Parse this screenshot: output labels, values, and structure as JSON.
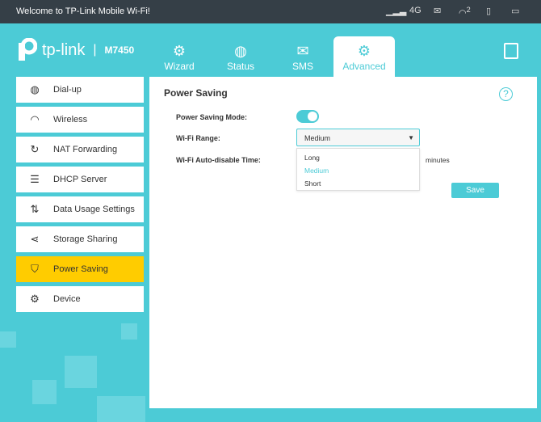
{
  "topbar": {
    "welcome": "Welcome to TP-Link Mobile Wi-Fi!",
    "network": "4G",
    "wifi_clients": "2"
  },
  "header": {
    "brand": "tp-link",
    "model": "M7450",
    "tabs": [
      {
        "label": "Wizard",
        "icon": "gear-icon"
      },
      {
        "label": "Status",
        "icon": "globe-icon"
      },
      {
        "label": "SMS",
        "icon": "envelope-icon"
      },
      {
        "label": "Advanced",
        "icon": "gears-icon",
        "active": true
      }
    ]
  },
  "sidebar": {
    "items": [
      {
        "label": "Dial-up"
      },
      {
        "label": "Wireless"
      },
      {
        "label": "NAT Forwarding"
      },
      {
        "label": "DHCP Server"
      },
      {
        "label": "Data Usage Settings"
      },
      {
        "label": "Storage Sharing"
      },
      {
        "label": "Power Saving",
        "active": true
      },
      {
        "label": "Device"
      }
    ]
  },
  "main": {
    "title": "Power Saving",
    "power_saving_mode_label": "Power Saving Mode:",
    "power_saving_mode": true,
    "wifi_range_label": "Wi-Fi Range:",
    "wifi_range_value": "Medium",
    "wifi_range_options": [
      "Long",
      "Medium",
      "Short"
    ],
    "auto_disable_label": "Wi-Fi Auto-disable Time:",
    "minutes_unit": "minutes",
    "save_label": "Save"
  },
  "colors": {
    "accent": "#4ccbd6",
    "topbar": "#353f47",
    "active_item": "#ffcc00"
  }
}
